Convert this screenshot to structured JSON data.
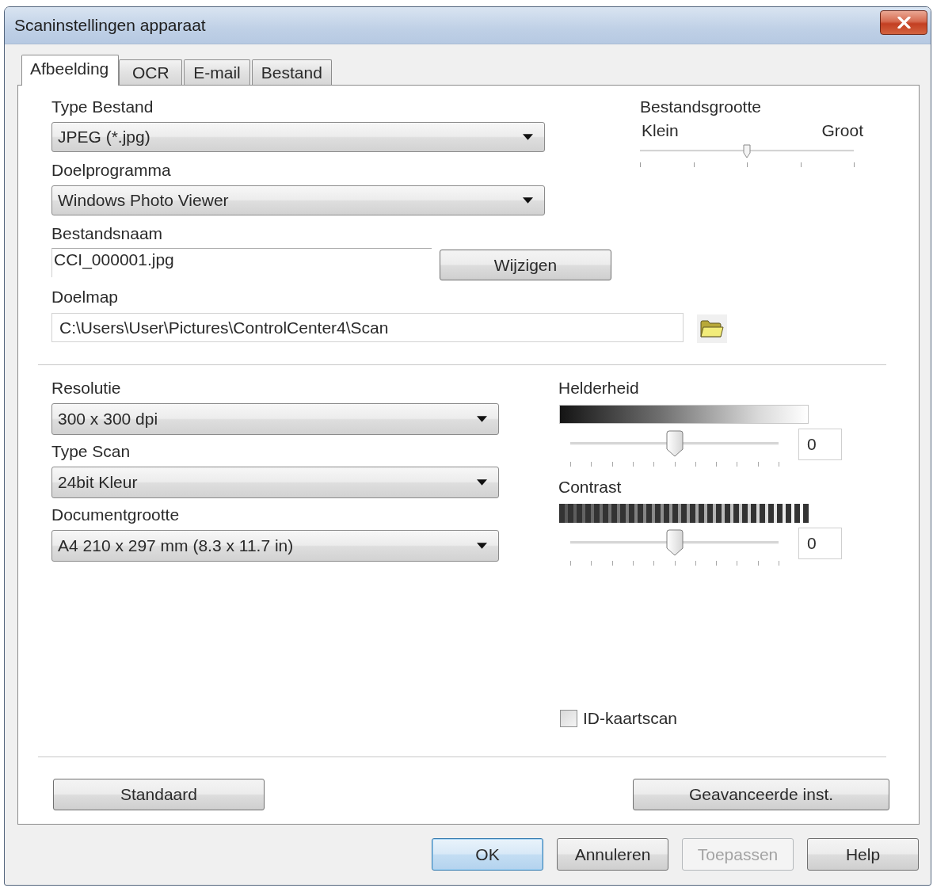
{
  "window": {
    "title": "Scaninstellingen apparaat"
  },
  "tabs": [
    {
      "label": "Afbeelding",
      "selected": true
    },
    {
      "label": "OCR",
      "selected": false
    },
    {
      "label": "E-mail",
      "selected": false
    },
    {
      "label": "Bestand",
      "selected": false
    }
  ],
  "file_fields": [
    {
      "kind": "dropdown",
      "label": "Type Bestand",
      "value": "JPEG (*.jpg)"
    },
    {
      "kind": "dropdown",
      "label": "Doelprogramma",
      "value": "Windows Photo Viewer"
    },
    {
      "kind": "name",
      "label": "Bestandsnaam",
      "value": "CCI_000001.jpg",
      "button": "Wijzigen"
    },
    {
      "kind": "folder",
      "label": "Doelmap",
      "value": "C:\\Users\\User\\Pictures\\ControlCenter4\\Scan"
    }
  ],
  "file_size": {
    "label": "Bestandsgrootte",
    "min_label": "Klein",
    "max_label": "Groot",
    "level": 0.5
  },
  "scan_fields": [
    {
      "label": "Resolutie",
      "value": "300 x 300 dpi"
    },
    {
      "label": "Type Scan",
      "value": "24bit Kleur"
    },
    {
      "label": "Documentgrootte",
      "value": "A4 210 x 297 mm (8.3 x 11.7 in)"
    }
  ],
  "adjustments": [
    {
      "kind": "brightness",
      "label": "Helderheid",
      "level": 0.5,
      "value": "0"
    },
    {
      "kind": "contrast",
      "label": "Contrast",
      "level": 0.5,
      "value": "0"
    }
  ],
  "id_card_scan": {
    "label": "ID-kaartscan",
    "checked": false
  },
  "panel_buttons": [
    {
      "label": "Standaard"
    },
    {
      "label": "Geavanceerde inst."
    }
  ],
  "dialog_buttons": [
    {
      "label": "OK",
      "default": true,
      "disabled": false
    },
    {
      "label": "Annuleren",
      "default": false,
      "disabled": false
    },
    {
      "label": "Toepassen",
      "default": false,
      "disabled": true
    },
    {
      "label": "Help",
      "default": false,
      "disabled": false
    }
  ]
}
